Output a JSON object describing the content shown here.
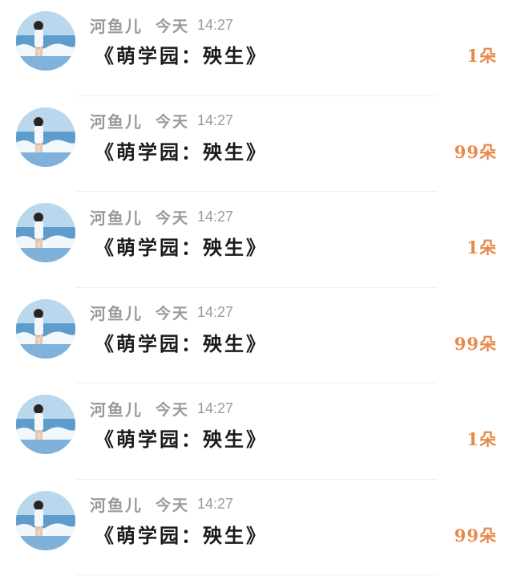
{
  "messages": [
    {
      "sender": "河鱼儿",
      "day": "今天",
      "time": "14:27",
      "gift": "《萌学园：殃生》",
      "count": "1朵"
    },
    {
      "sender": "河鱼儿",
      "day": "今天",
      "time": "14:27",
      "gift": "《萌学园：殃生》",
      "count": "99朵"
    },
    {
      "sender": "河鱼儿",
      "day": "今天",
      "time": "14:27",
      "gift": "《萌学园：殃生》",
      "count": "1朵"
    },
    {
      "sender": "河鱼儿",
      "day": "今天",
      "time": "14:27",
      "gift": "《萌学园：殃生》",
      "count": "99朵"
    },
    {
      "sender": "河鱼儿",
      "day": "今天",
      "time": "14:27",
      "gift": "《萌学园：殃生》",
      "count": "1朵"
    },
    {
      "sender": "河鱼儿",
      "day": "今天",
      "time": "14:27",
      "gift": "《萌学园：殃生》",
      "count": "99朵"
    }
  ],
  "colors": {
    "meta_text": "#9a9a9a",
    "title_text": "#1a1a1a",
    "count_text": "#e8894a",
    "divider": "#efefef"
  },
  "icons": {
    "avatar": "user-avatar-beach-photo"
  }
}
